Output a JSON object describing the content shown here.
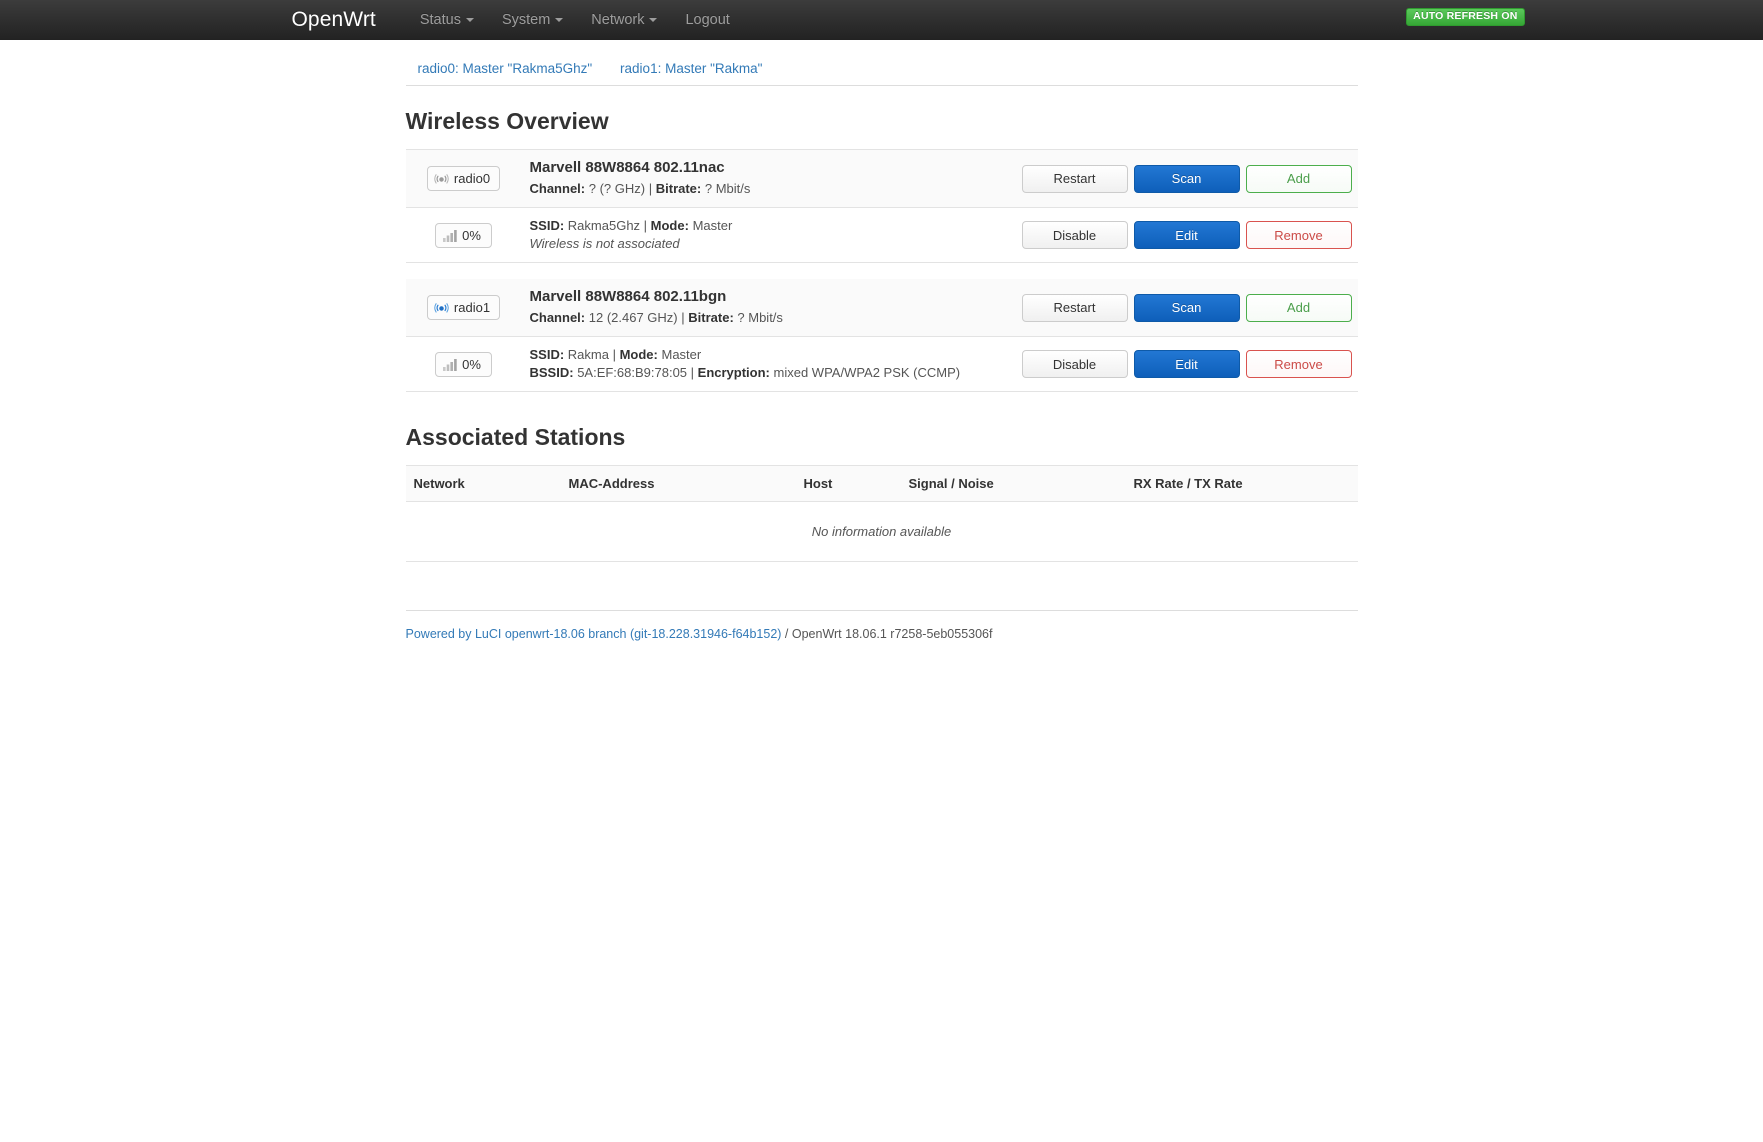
{
  "header": {
    "brand": "OpenWrt",
    "nav": [
      {
        "label": "Status",
        "has_caret": true
      },
      {
        "label": "System",
        "has_caret": true
      },
      {
        "label": "Network",
        "has_caret": true
      },
      {
        "label": "Logout",
        "has_caret": false
      }
    ],
    "auto_refresh_badge": "AUTO REFRESH ON",
    "badge_color": "#35a735"
  },
  "tabs": [
    {
      "label": "radio0: Master \"Rakma5Ghz\""
    },
    {
      "label": "radio1: Master \"Rakma\""
    }
  ],
  "wireless_overview": {
    "title": "Wireless Overview",
    "radios": [
      {
        "device_badge": "radio0",
        "device_icon": "wifi-antenna-icon-disabled",
        "device_title": "Marvell 88W8864 802.11nac",
        "channel_label": "Channel:",
        "channel_value": "? (? GHz)",
        "separator": "|",
        "bitrate_label": "Bitrate:",
        "bitrate_value": "? Mbit/s",
        "actions": [
          {
            "label": "Restart",
            "style": "default"
          },
          {
            "label": "Scan",
            "style": "primary"
          },
          {
            "label": "Add",
            "style": "add"
          }
        ],
        "interfaces": [
          {
            "signal_badge": "0%",
            "signal_icon": "signal-bars-icon",
            "ssid_label": "SSID:",
            "ssid_value": "Rakma5Ghz",
            "mode_label": "Mode:",
            "mode_value": "Master",
            "status_text": "Wireless is not associated",
            "bssid_label": "",
            "bssid_value": "",
            "encryption_label": "",
            "encryption_value": "",
            "actions": [
              {
                "label": "Disable",
                "style": "default"
              },
              {
                "label": "Edit",
                "style": "primary"
              },
              {
                "label": "Remove",
                "style": "remove"
              }
            ]
          }
        ]
      },
      {
        "device_badge": "radio1",
        "device_icon": "wifi-antenna-icon-active",
        "device_title": "Marvell 88W8864 802.11bgn",
        "channel_label": "Channel:",
        "channel_value": "12 (2.467 GHz)",
        "separator": "|",
        "bitrate_label": "Bitrate:",
        "bitrate_value": "? Mbit/s",
        "actions": [
          {
            "label": "Restart",
            "style": "default"
          },
          {
            "label": "Scan",
            "style": "primary"
          },
          {
            "label": "Add",
            "style": "add"
          }
        ],
        "interfaces": [
          {
            "signal_badge": "0%",
            "signal_icon": "signal-bars-icon",
            "ssid_label": "SSID:",
            "ssid_value": "Rakma",
            "mode_label": "Mode:",
            "mode_value": "Master",
            "status_text": "",
            "bssid_label": "BSSID:",
            "bssid_value": "5A:EF:68:B9:78:05",
            "encryption_label": "Encryption:",
            "encryption_value": "mixed WPA/WPA2 PSK (CCMP)",
            "actions": [
              {
                "label": "Disable",
                "style": "default"
              },
              {
                "label": "Edit",
                "style": "primary"
              },
              {
                "label": "Remove",
                "style": "remove"
              }
            ]
          }
        ]
      }
    ]
  },
  "associated_stations": {
    "title": "Associated Stations",
    "columns": [
      "Network",
      "MAC-Address",
      "Host",
      "Signal / Noise",
      "RX Rate / TX Rate"
    ],
    "empty_message": "No information available"
  },
  "footer": {
    "link_text": "Powered by LuCI openwrt-18.06 branch (git-18.228.31946-f64b152)",
    "suffix_text": " / OpenWrt 18.06.1 r7258-5eb055306f"
  }
}
